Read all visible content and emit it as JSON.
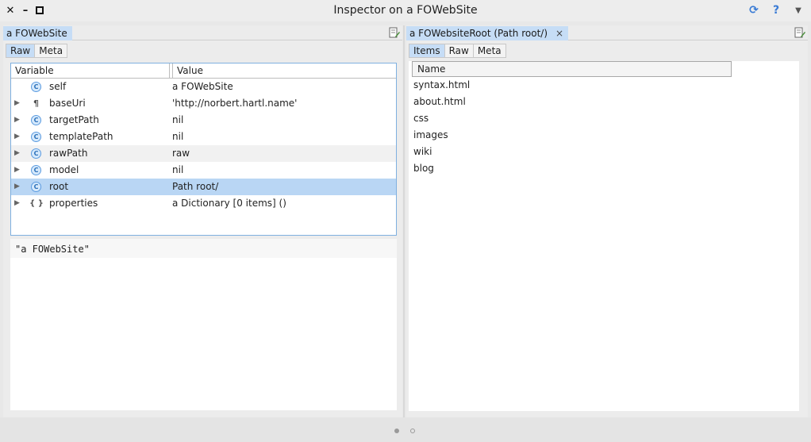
{
  "window": {
    "title": "Inspector on a FOWebSite",
    "controls": [
      "close-icon",
      "minimize-icon",
      "maximize-icon"
    ],
    "title_icons": [
      "refresh-icon",
      "help-icon",
      "menu-dropdown-icon"
    ]
  },
  "left_pane": {
    "tab_label": "a FOWebSite",
    "subtabs": [
      "Raw",
      "Meta"
    ],
    "active_subtab": "Raw",
    "columns": [
      "Variable",
      "Value"
    ],
    "rows": [
      {
        "variable": "self",
        "value": "a FOWebSite",
        "kind": "C",
        "expandable": false
      },
      {
        "variable": "baseUri",
        "value": "'http://norbert.hartl.name'",
        "kind": "¶",
        "expandable": true
      },
      {
        "variable": "targetPath",
        "value": "nil",
        "kind": "C",
        "expandable": true
      },
      {
        "variable": "templatePath",
        "value": "nil",
        "kind": "C",
        "expandable": true
      },
      {
        "variable": "rawPath",
        "value": "raw",
        "kind": "C",
        "expandable": true
      },
      {
        "variable": "model",
        "value": "nil",
        "kind": "C",
        "expandable": true
      },
      {
        "variable": "root",
        "value": "Path root/",
        "kind": "C",
        "expandable": true
      },
      {
        "variable": "properties",
        "value": "a Dictionary [0 items] ()",
        "kind": "{ }",
        "expandable": true
      }
    ],
    "selected_row": "root",
    "code": "\"a FOWebSite\""
  },
  "right_pane": {
    "tab_label": "a FOWebsiteRoot (Path root/)",
    "tab_close": "×",
    "subtabs": [
      "Items",
      "Raw",
      "Meta"
    ],
    "active_subtab": "Items",
    "column": "Name",
    "items": [
      "syntax.html",
      "about.html",
      "css",
      "images",
      "wiki",
      "blog"
    ]
  },
  "pager": {
    "pages": 2,
    "current": 1
  },
  "colors": {
    "selection": "#b9d6f4",
    "tab_active": "#c6ddf6",
    "accent": "#3a7bd5"
  }
}
